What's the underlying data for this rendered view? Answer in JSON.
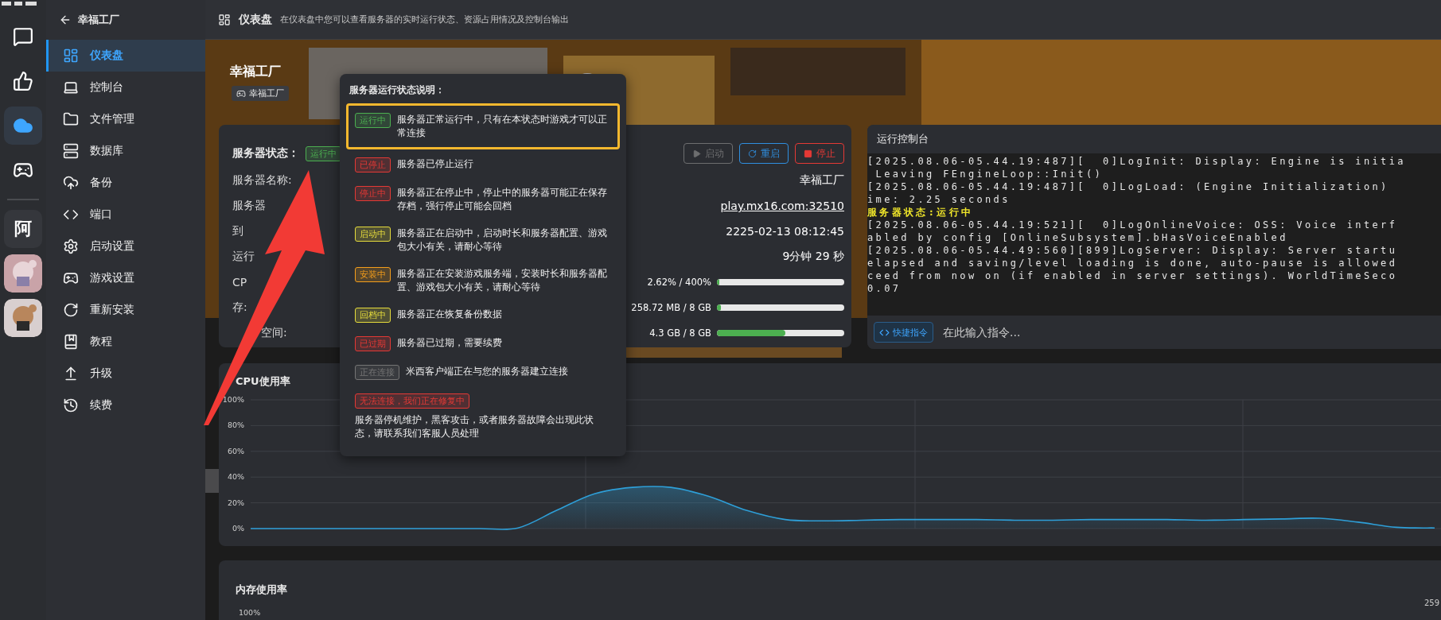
{
  "rail": [
    {
      "kind": "icon",
      "selected": false
    },
    {
      "kind": "icon",
      "selected": false
    },
    {
      "kind": "icon",
      "selected": true
    },
    {
      "kind": "icon",
      "selected": false
    },
    {
      "kind": "divider"
    },
    {
      "kind": "text",
      "label": "阿",
      "selected": false
    },
    {
      "kind": "picture"
    },
    {
      "kind": "picture"
    }
  ],
  "sidebar": {
    "back_label": "幸福工厂",
    "items": [
      {
        "label": "仪表盘",
        "selected": true
      },
      {
        "label": "控制台",
        "selected": false
      },
      {
        "label": "文件管理",
        "selected": false
      },
      {
        "label": "数据库",
        "selected": false
      },
      {
        "label": "备份",
        "selected": false
      },
      {
        "label": "端口",
        "selected": false
      },
      {
        "label": "启动设置",
        "selected": false
      },
      {
        "label": "游戏设置",
        "selected": false
      },
      {
        "label": "重新安装",
        "selected": false
      },
      {
        "label": "教程",
        "selected": false
      },
      {
        "label": "升级",
        "selected": false
      },
      {
        "label": "续费",
        "selected": false
      }
    ]
  },
  "header": {
    "title": "仪表盘",
    "description": "在仪表盘中您可以查看服务器的实时运行状态、资源占用情况及控制台输出"
  },
  "server": {
    "name": "幸福工厂",
    "tag": "幸福工厂"
  },
  "server_card": {
    "status_label": "服务器状态：",
    "status_badge": {
      "label": "运行中",
      "color": "#4caf50"
    },
    "buttons": [
      {
        "kind": "start",
        "label": "启动",
        "disabled": true
      },
      {
        "kind": "restart",
        "label": "重启",
        "disabled": false
      },
      {
        "kind": "stop",
        "label": "停止",
        "disabled": false
      }
    ],
    "rows": [
      {
        "kind": "text",
        "label": "服务器名称:",
        "value": "幸福工厂"
      },
      {
        "kind": "link",
        "label": "服务器",
        "value": "play.mx16.com:32510"
      },
      {
        "kind": "text",
        "label": "到",
        "value": "2225-02-13 08:12:45"
      },
      {
        "kind": "text",
        "label": "运行",
        "value": "9分钟 29 秒"
      },
      {
        "kind": "meter",
        "label": "CP",
        "value": "2.62% / 400%",
        "level": 0.01
      },
      {
        "kind": "meter",
        "label": "存:",
        "value": "258.72 MB / 8 GB",
        "level": 0.03
      },
      {
        "kind": "meter",
        "label": "空间:",
        "covered": true,
        "value": "4.3 GB / 8 GB",
        "level": 0.54
      }
    ]
  },
  "console": {
    "title": "运行控制台",
    "lines": [
      {
        "kind": "log",
        "text": "[2025.08.06-05.44.19:487][  0]LogInit: Display: Engine is initia"
      },
      {
        "kind": "log",
        "text": " Leaving FEngineLoop::Init()"
      },
      {
        "kind": "log",
        "text": "[2025.08.06-05.44.19:487][  0]LogLoad: (Engine Initialization)"
      },
      {
        "kind": "log",
        "text": "ime: 2.25 seconds"
      },
      {
        "kind": "status",
        "text": "服务器状态:运行中"
      },
      {
        "kind": "log",
        "text": "[2025.08.06-05.44.19:521][  0]LogOnlineVoice: OSS: Voice interf"
      },
      {
        "kind": "log",
        "text": "abled by config [OnlineSubsystem].bHasVoiceEnabled"
      },
      {
        "kind": "log",
        "text": "[2025.08.06-05.44.49:560][899]LogServer: Display: Server startu"
      },
      {
        "kind": "log",
        "text": "elapsed and saving/level loading is done, auto-pause is allowed"
      },
      {
        "kind": "log",
        "text": "ceed from now on (if enabled in server settings). WorldTimeSeco"
      },
      {
        "kind": "log",
        "text": "0.07"
      }
    ],
    "quick_button": "快捷指令",
    "input_placeholder": "在此输入指令..."
  },
  "status_legend": {
    "title": "服务器运行状态说明：",
    "items": [
      {
        "badge": "运行中",
        "color": "#4caf50",
        "description": "服务器正常运行中，只有在本状态时游戏才可以正常连接",
        "highlighted": true,
        "kind": "inline"
      },
      {
        "badge": "已停止",
        "color": "#e53935",
        "description": "服务器已停止运行",
        "highlighted": false,
        "kind": "inline"
      },
      {
        "badge": "停止中",
        "color": "#e53935",
        "description": "服务器正在停止中，停止中的服务器可能正在保存存档，强行停止可能会回档",
        "highlighted": false,
        "kind": "inline"
      },
      {
        "badge": "启动中",
        "color": "#e6dc3c",
        "description": "服务器正在启动中，启动时长和服务器配置、游戏包大小有关，请耐心等待",
        "highlighted": false,
        "kind": "inline"
      },
      {
        "badge": "安装中",
        "color": "#f59e1b",
        "description": "服务器正在安装游戏服务端，安装时长和服务器配置、游戏包大小有关，请耐心等待",
        "highlighted": false,
        "kind": "inline"
      },
      {
        "badge": "回档中",
        "color": "#e6dc3c",
        "description": "服务器正在恢复备份数据",
        "highlighted": false,
        "kind": "inline"
      },
      {
        "badge": "已过期",
        "color": "#e53935",
        "description": "服务器已过期，需要续费",
        "highlighted": false,
        "kind": "inline"
      },
      {
        "badge": "正在连接",
        "color": "#757575",
        "description": "米西客户端正在与您的服务器建立连接",
        "highlighted": false,
        "kind": "inline"
      },
      {
        "badge": "无法连接，我们正在修复中",
        "color": "#e53935",
        "description": "服务器停机维护，黑客攻击，或者服务器故障会出现此状态，请联系我们客服人员处理",
        "highlighted": false,
        "kind": "stacked"
      }
    ]
  },
  "cpu_chart": {
    "title": "CPU使用率",
    "chart_data": {
      "type": "area",
      "ylim": [
        0,
        100
      ],
      "grid": true,
      "yticks": [
        {
          "value": 0,
          "label": "0%"
        },
        {
          "value": 20,
          "label": "20%"
        },
        {
          "value": 40,
          "label": "40%"
        },
        {
          "value": 60,
          "label": "60%"
        },
        {
          "value": 80,
          "label": "80%"
        },
        {
          "value": 100,
          "label": "100%"
        }
      ],
      "values": [
        0,
        0,
        0,
        0,
        0,
        0,
        0,
        0.5,
        14,
        27,
        32,
        32,
        25,
        14,
        7,
        6,
        6.5,
        7,
        7,
        7,
        6.5,
        6.5,
        7,
        7,
        7,
        6.5,
        7,
        7.5,
        8,
        5,
        1,
        0.5
      ]
    }
  },
  "memory_chart": {
    "title": "内存使用率",
    "top_tick": "100%",
    "right_label": "259"
  }
}
